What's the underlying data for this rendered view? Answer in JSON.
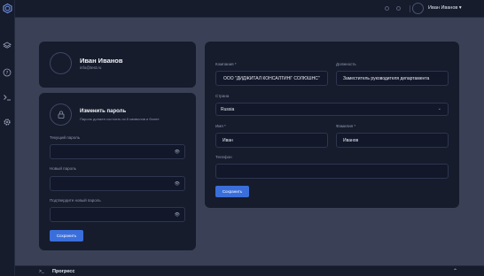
{
  "topbar": {
    "user_name": "Иван Иванов",
    "user_dropdown_icon": "chevron-down-icon"
  },
  "sidebar": {
    "items": [
      {
        "icon": "layers-icon"
      },
      {
        "icon": "help-icon"
      },
      {
        "icon": "terminal-icon"
      },
      {
        "icon": "gear-icon"
      }
    ]
  },
  "profile": {
    "name": "Иван Иванов",
    "email": "info@test.ru"
  },
  "password": {
    "title": "Изменить пароль",
    "subtitle": "Пароль должен состоять из 8 символов и более",
    "current_label": "Текущий пароль",
    "new_label": "Новый пароль",
    "confirm_label": "Подтвердите новый пароль",
    "save_label": "Сохранить"
  },
  "info": {
    "company_label": "Компания *",
    "company_value": "ООО \"ДИДЖИТАЛ КОНСАЛТИНГ СОЛЮШНС\"",
    "position_label": "Должность",
    "position_value": "Заместитель руководителя департамента",
    "country_label": "Страна",
    "country_value": "Russia",
    "first_name_label": "Имя *",
    "first_name_value": "Иван",
    "last_name_label": "Фамилия *",
    "last_name_value": "Иванов",
    "phone_label": "Телефон",
    "phone_value": "",
    "save_label": "Сохранить"
  },
  "bottombar": {
    "title": "Прогресс"
  },
  "colors": {
    "accent": "#3a6fdb",
    "card_bg": "#161c2c",
    "page_bg": "#3a4055"
  }
}
